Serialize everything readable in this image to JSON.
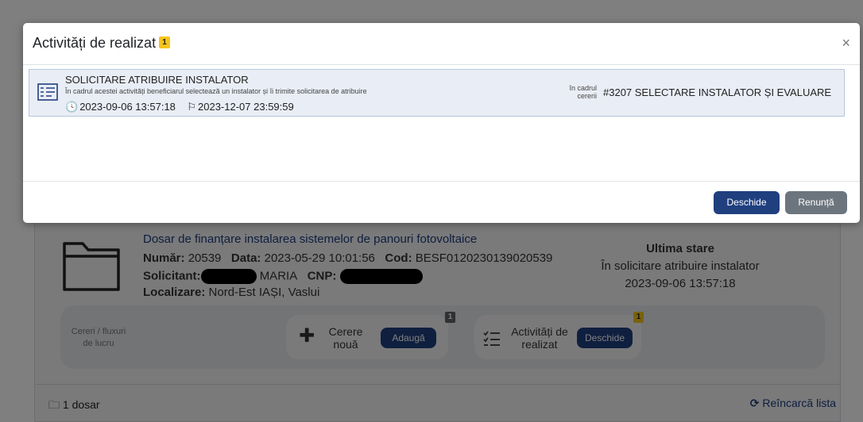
{
  "background": {
    "dosar": {
      "title": "Dosar de finanțare instalarea sistemelor de panouri fotovoltaice",
      "numar_label": "Număr:",
      "numar_value": "20539",
      "data_label": "Data:",
      "data_value": "2023-05-29 10:01:56",
      "cod_label": "Cod:",
      "cod_value": "BESF0120230139020539",
      "solicitant_label": "Solicitant:",
      "solicitant_value": "MARIA",
      "cnp_label": "CNP:",
      "localizare_label": "Localizare:",
      "localizare_value": "Nord-Est IAȘI,  Vaslui"
    },
    "last_state": {
      "heading": "Ultima stare",
      "status": "În solicitare atribuire instalator",
      "timestamp": "2023-09-06 13:57:18"
    },
    "fluxuri": {
      "label_line1": "Cereri / fluxuri",
      "label_line2": "de lucru",
      "cerere": {
        "line1": "Cerere",
        "line2": "nouă",
        "button": "Adaugă",
        "badge": "1"
      },
      "activitati": {
        "line1": "Activități de",
        "line2": "realizat",
        "button": "Deschide",
        "badge": "1"
      }
    },
    "footer": {
      "count": "1 dosar",
      "reload": "Reîncarcă lista"
    }
  },
  "modal": {
    "title": "Activități de realizat",
    "title_badge": "1",
    "close": "×",
    "activity": {
      "title": "SOLICITARE ATRIBUIRE INSTALATOR",
      "description": "În cadrul acestei activități beneficiarul selectează un instalator și îi trimite solicitarea de atribuire",
      "start": "2023-09-06 13:57:18",
      "deadline": "2023-12-07 23:59:59",
      "cadrul_line1": "în cadrul",
      "cadrul_line2": "cererii",
      "reference": "#3207  SELECTARE INSTALATOR ȘI EVALUARE"
    },
    "buttons": {
      "open": "Deschide",
      "cancel": "Renunță"
    }
  },
  "colors": {
    "primary": "#1f3f7f",
    "secondary": "#6c757d",
    "badge_yellow": "#f5c518",
    "row_selected": "#e9edf5"
  },
  "icons": {
    "folder": "folder-icon",
    "plus": "plus-icon",
    "checklist": "checklist-icon",
    "clock": "clock-icon",
    "flag": "flag-icon",
    "reload": "reload-icon",
    "close": "close-icon"
  }
}
